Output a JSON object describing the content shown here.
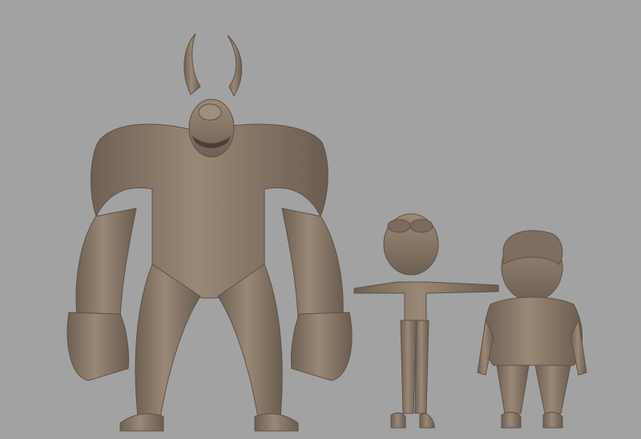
{
  "scene": {
    "background_color": "#a2a2a2",
    "clay_color": "#8c7a68",
    "clay_shadow": "#5e5145",
    "clay_highlight": "#a8978a",
    "figures": [
      "horned-cyclops-monster",
      "girl-with-goggles-t-pose",
      "boy-character"
    ]
  }
}
